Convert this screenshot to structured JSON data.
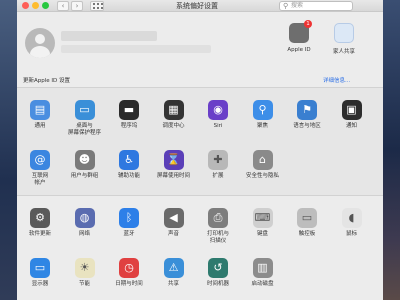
{
  "window": {
    "title": "系统偏好设置",
    "search_placeholder": "搜索"
  },
  "controls": {
    "back": "‹",
    "forward": "›"
  },
  "account": {
    "apple_id_label": "Apple ID",
    "apple_id_badge": "1",
    "family_label": "家人共享",
    "notice": "更新Apple ID 设置",
    "notice_link": "详细信息..."
  },
  "row1": [
    {
      "label": "通用",
      "icon": "general-icon",
      "color": "#4a8ee0",
      "glyph": "▤"
    },
    {
      "label": "桌面与\n屏幕保护程序",
      "icon": "desktop-screensaver-icon",
      "color": "#3a8fd8",
      "glyph": "▭"
    },
    {
      "label": "程序坞",
      "icon": "dock-icon",
      "color": "#2b2b2b",
      "glyph": "▬"
    },
    {
      "label": "调度中心",
      "icon": "mission-control-icon",
      "color": "#343434",
      "glyph": "▦"
    },
    {
      "label": "Siri",
      "icon": "siri-icon",
      "color": "#6a3fc8",
      "glyph": "◉"
    },
    {
      "label": "聚焦",
      "icon": "spotlight-icon",
      "color": "#3d8ee8",
      "glyph": "⚲"
    },
    {
      "label": "语言与地区",
      "icon": "language-region-icon",
      "color": "#3a7fd0",
      "glyph": "⚑"
    },
    {
      "label": "通知",
      "icon": "notifications-icon",
      "color": "#2d2d2d",
      "glyph": "▣"
    }
  ],
  "row2": [
    {
      "label": "互联网\n帐户",
      "icon": "internet-accounts-icon",
      "color": "#3b86e0",
      "glyph": "@"
    },
    {
      "label": "用户与群组",
      "icon": "users-groups-icon",
      "color": "#7a7a7a",
      "glyph": "☻"
    },
    {
      "label": "辅助功能",
      "icon": "accessibility-icon",
      "color": "#2e78e0",
      "glyph": "♿"
    },
    {
      "label": "屏幕使用时间",
      "icon": "screen-time-icon",
      "color": "#5b3fb8",
      "glyph": "⌛"
    },
    {
      "label": "扩展",
      "icon": "extensions-icon",
      "color": "#b8b8b8",
      "glyph": "✚"
    },
    {
      "label": "安全性与隐私",
      "icon": "security-privacy-icon",
      "color": "#8a8a8a",
      "glyph": "⌂"
    }
  ],
  "row3": [
    {
      "label": "软件更新",
      "icon": "software-update-icon",
      "color": "#5a5a5a",
      "glyph": "⚙"
    },
    {
      "label": "网络",
      "icon": "network-icon",
      "color": "#5a6cb0",
      "glyph": "◍"
    },
    {
      "label": "蓝牙",
      "icon": "bluetooth-icon",
      "color": "#2d7fe8",
      "glyph": "ᛒ"
    },
    {
      "label": "声音",
      "icon": "sound-icon",
      "color": "#6a6a6a",
      "glyph": "◀"
    },
    {
      "label": "打印机与\n扫描仪",
      "icon": "printers-scanners-icon",
      "color": "#7d7d7d",
      "glyph": "⎙"
    },
    {
      "label": "键盘",
      "icon": "keyboard-icon",
      "color": "#cfcfcf",
      "glyph": "⌨"
    },
    {
      "label": "触控板",
      "icon": "trackpad-icon",
      "color": "#bdbdbd",
      "glyph": "▭"
    },
    {
      "label": "鼠标",
      "icon": "mouse-icon",
      "color": "#e4e4e4",
      "glyph": "◖"
    }
  ],
  "row4": [
    {
      "label": "显示器",
      "icon": "displays-icon",
      "color": "#2f86e4",
      "glyph": "▭"
    },
    {
      "label": "节能",
      "icon": "energy-saver-icon",
      "color": "#e9e3c0",
      "glyph": "☀"
    },
    {
      "label": "日期与时间",
      "icon": "date-time-icon",
      "color": "#e04040",
      "glyph": "◷"
    },
    {
      "label": "共享",
      "icon": "sharing-icon",
      "color": "#3a8fd8",
      "glyph": "⚠"
    },
    {
      "label": "时间机器",
      "icon": "time-machine-icon",
      "color": "#2e7a6e",
      "glyph": "↺"
    },
    {
      "label": "启动磁盘",
      "icon": "startup-disk-icon",
      "color": "#8c8c8c",
      "glyph": "▥"
    }
  ]
}
